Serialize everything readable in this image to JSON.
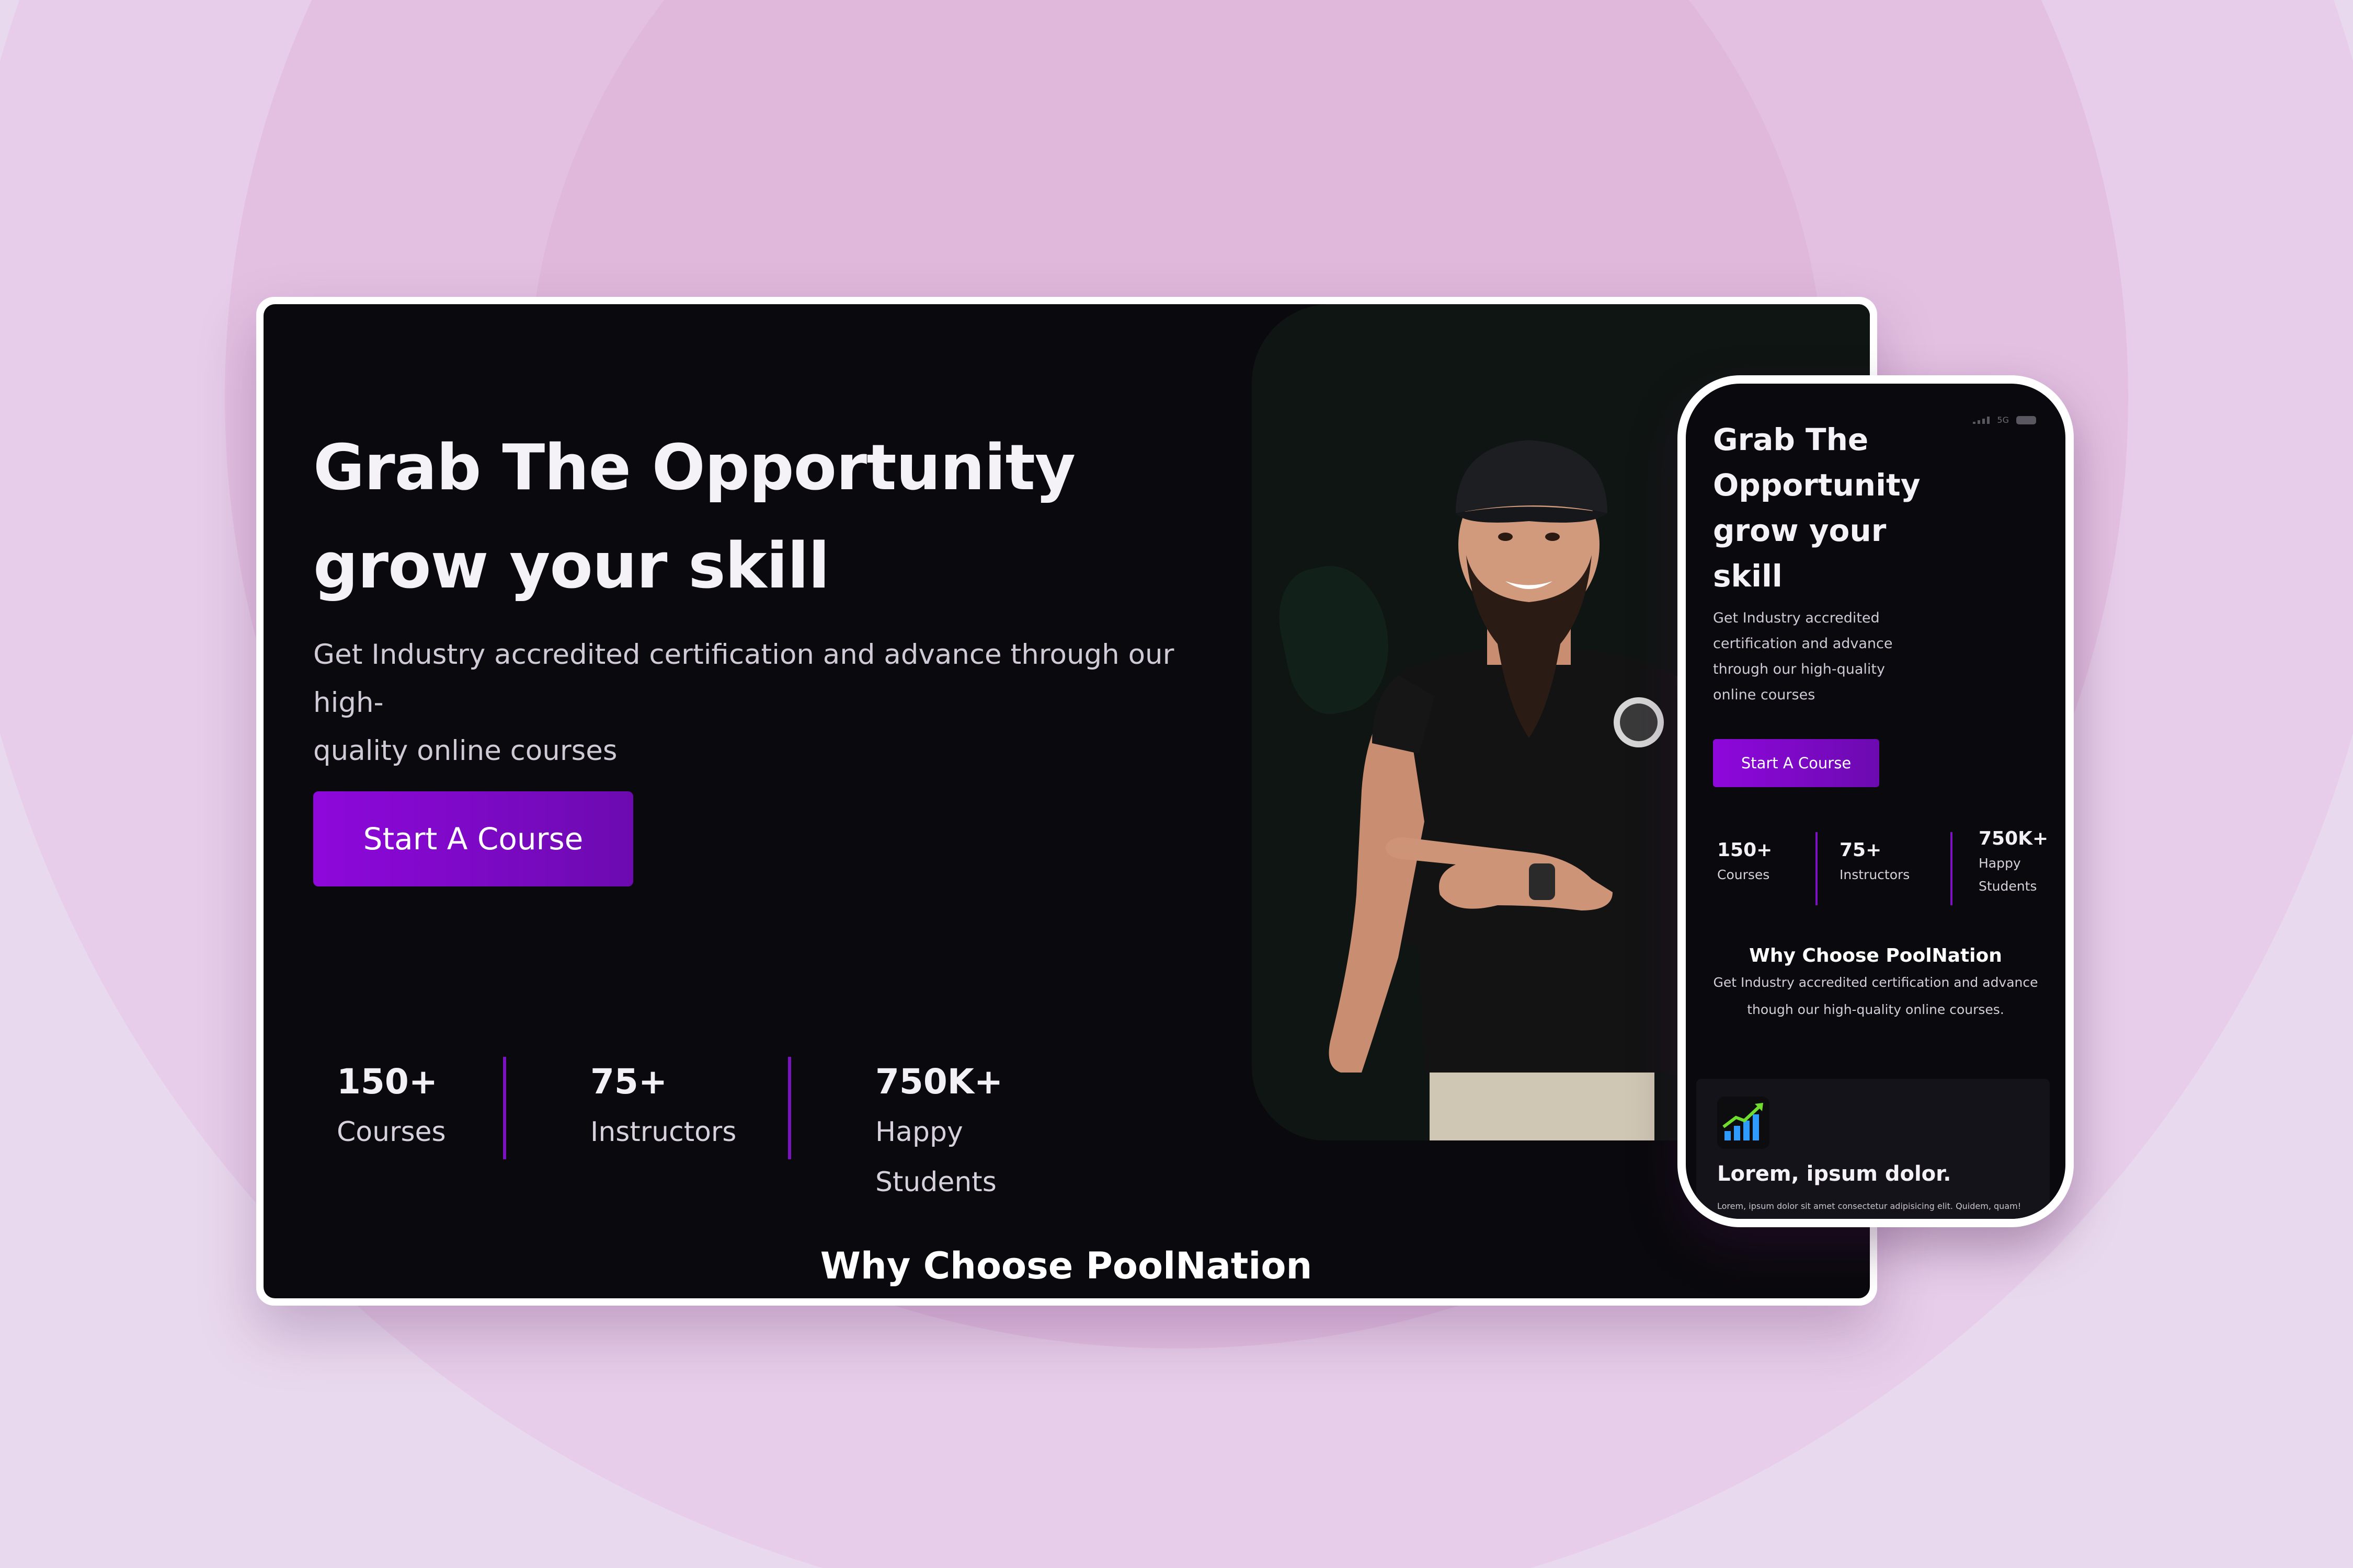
{
  "desktop": {
    "hero": {
      "title_line1": "Grab The Opportunity",
      "title_line2": "grow your skill",
      "subtitle_line1": "Get Industry accredited certification and advance through our high-",
      "subtitle_line2": "quality online courses",
      "cta_label": "Start A Course"
    },
    "stats": [
      {
        "value": "150+",
        "label": "Courses"
      },
      {
        "value": "75+",
        "label": "Instructors"
      },
      {
        "value": "750K+",
        "label": "Happy Students"
      }
    ],
    "why_heading": "Why Choose PoolNation"
  },
  "mobile": {
    "hero": {
      "title_lines": [
        "Grab The",
        "Opportunity",
        "grow your",
        "skill"
      ],
      "subtitle_lines": [
        "Get Industry accredited",
        "certification and advance",
        "through our high-quality",
        "online courses"
      ],
      "cta_label": "Start A Course"
    },
    "status_bar": {
      "network": "5G"
    },
    "stats": [
      {
        "value": "150+",
        "label_lines": [
          "Courses"
        ]
      },
      {
        "value": "75+",
        "label_lines": [
          "Instructors"
        ]
      },
      {
        "value": "750K+",
        "label_lines": [
          "Happy",
          "Students"
        ]
      }
    ],
    "why_heading": "Why Choose PoolNation",
    "why_sub_line1": "Get Industry accredited certification and advance",
    "why_sub_line2": "though our high-quality online courses.",
    "card": {
      "icon": "growth-chart-icon",
      "title": "Lorem, ipsum dolor.",
      "text": "Lorem, ipsum dolor sit amet consectetur adipisicing elit. Quidem, quam!"
    }
  },
  "colors": {
    "accent_purple": "#8e08db",
    "divider_purple": "#7a12c0",
    "screen_bg": "#0a090d",
    "page_bg": "#e9d9ee"
  }
}
